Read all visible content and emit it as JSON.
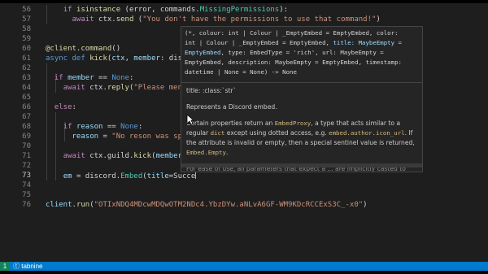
{
  "editor": {
    "line_numbers": [
      "56",
      "57",
      "58",
      "59",
      "60",
      "61",
      "62",
      "63",
      "64",
      "65",
      "66",
      "67",
      "68",
      "69",
      "70",
      "71",
      "72",
      "73",
      "74",
      "75",
      "76"
    ],
    "current_line": "73"
  },
  "hover": {
    "signature_lines": [
      [
        "(*, colour: int | Colour | _EmptyEmbed = EmptyEmbed, color:",
        ""
      ],
      [
        "int | Colour | _EmptyEmbed = EmptyEmbed, ",
        "title: MaybeEmpty ="
      ],
      [
        "EmptyEmbed",
        ", type: EmbedType = 'rich', url: MaybeEmpty ="
      ],
      [
        "EmptyEmbed, description: MaybeEmpty = EmptyEmbed, timestamp:",
        ""
      ],
      [
        "datetime | None = None) -> None",
        ""
      ]
    ],
    "doc_title": "title: :class:`str`",
    "doc_represents": "Represents a Discord embed.",
    "doc_p1_a": "Certain properties return an ",
    "doc_p1_code1": "EmbedProxy",
    "doc_p1_b": ", a type that acts similar to a regular ",
    "doc_p1_code2": "dict",
    "doc_p1_c": " except using dotted access, e.g. ",
    "doc_p1_code3": "embed.author.icon_url",
    "doc_p1_d": ". If the attribute is invalid or empty, then a special sentinel value is returned, ",
    "doc_p1_code4": "Embed.Empty",
    "doc_p1_e": ".",
    "doc_cutoff": "For ease of use, all parameters that expect a ... are implicitly casted to"
  },
  "statusbar": {
    "left_text": "1",
    "right_text": "tabnine"
  },
  "colors": {
    "editor_bg": "#1e1e1e",
    "status_bar": "#007acc",
    "keyword": "#569cd6",
    "control": "#c586c0",
    "string": "#ce9178",
    "function": "#dcdcaa"
  }
}
